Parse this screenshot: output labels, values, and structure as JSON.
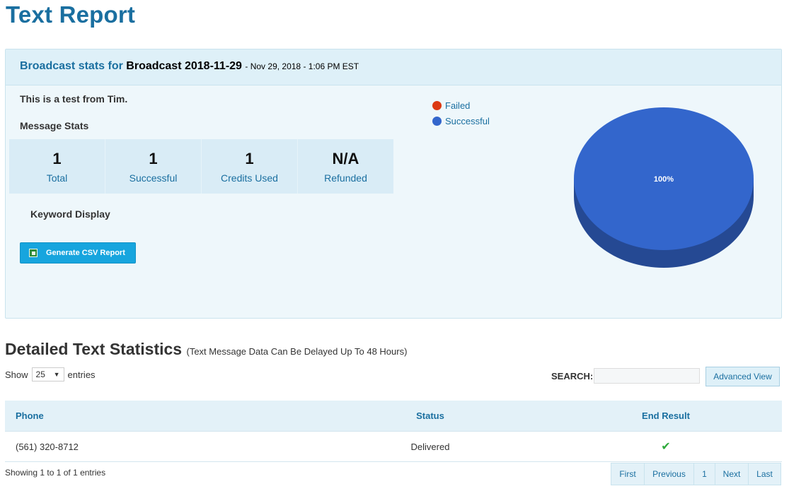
{
  "page": {
    "title": "Text Report"
  },
  "broadcast": {
    "label": "Broadcast stats for",
    "name": "Broadcast 2018-11-29",
    "date": "- Nov 29, 2018 - 1:06 PM EST",
    "message": "This is a test from Tim."
  },
  "message_stats": {
    "title": "Message Stats",
    "items": [
      {
        "value": "1",
        "label": "Total"
      },
      {
        "value": "1",
        "label": "Successful"
      },
      {
        "value": "1",
        "label": "Credits Used"
      },
      {
        "value": "N/A",
        "label": "Refunded"
      }
    ]
  },
  "keyword": {
    "title": "Keyword Display"
  },
  "csv_button": {
    "label": "Generate CSV Report"
  },
  "chart_data": {
    "type": "pie",
    "legend": [
      {
        "name": "Failed",
        "color": "#dc3912"
      },
      {
        "name": "Successful",
        "color": "#3366cc"
      }
    ],
    "values": [
      0,
      100
    ],
    "slice_labels": [
      "",
      "100%"
    ],
    "legend_position": "top-left"
  },
  "details": {
    "title": "Detailed Text Statistics",
    "subtitle": "(Text Message Data Can Be Delayed Up To 48 Hours)",
    "show_label": "Show",
    "page_size": "25",
    "entries_label": "entries",
    "search_label": "SEARCH:",
    "advanced_label": "Advanced View",
    "columns": [
      "Phone",
      "Status",
      "End Result"
    ],
    "rows": [
      {
        "phone": "(561) 320-8712",
        "status": "Delivered",
        "result": "✔"
      }
    ],
    "showing": "Showing 1 to 1 of 1 entries"
  },
  "pager": {
    "first": "First",
    "previous": "Previous",
    "page": "1",
    "next": "Next",
    "last": "Last"
  }
}
